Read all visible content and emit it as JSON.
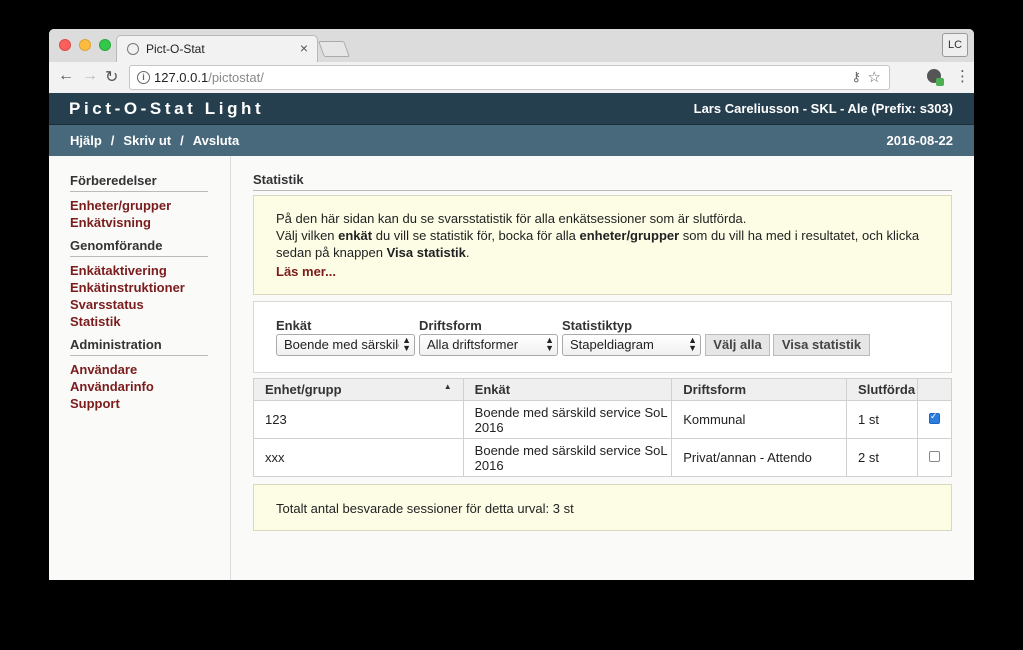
{
  "browser": {
    "tab_title": "Pict-O-Stat",
    "tab_close": "×",
    "profile": "LC",
    "url_host": "127.0.0.1",
    "url_path": "/pictostat/"
  },
  "header": {
    "app_title": "Pict-O-Stat Light",
    "user": "Lars Careliusson - SKL - Ale (Prefix: s303)"
  },
  "menu": {
    "items": [
      "Hjälp",
      "Skriv ut",
      "Avsluta"
    ],
    "separator": "/",
    "date": "2016-08-22"
  },
  "sidebar": {
    "sections": [
      {
        "heading": "Förberedelser",
        "items": [
          "Enheter/grupper",
          "Enkätvisning"
        ]
      },
      {
        "heading": "Genomförande",
        "items": [
          "Enkätaktivering",
          "Enkätinstruktioner",
          "Svarsstatus",
          "Statistik"
        ]
      },
      {
        "heading": "Administration",
        "items": [
          "Användare",
          "Användarinfo",
          "Support"
        ]
      }
    ]
  },
  "main": {
    "title": "Statistik",
    "info": {
      "line1": "På den här sidan kan du se svarsstatistik för alla enkätsessioner som är slutförda.",
      "line2_a": "Välj vilken ",
      "line2_b": "enkät",
      "line2_c": " du vill se statistik för, bocka för alla ",
      "line2_d": "enheter/grupper",
      "line2_e": " som du vill ha med i resultatet, och klicka",
      "line3_a": "sedan på knappen ",
      "line3_b": "Visa statistik",
      "line3_c": ".",
      "more": "Läs mer..."
    },
    "filters": {
      "enkat_label": "Enkät",
      "enkat_value": "Boende med särskild service SoL 2016",
      "driftsform_label": "Driftsform",
      "driftsform_value": "Alla driftsformer",
      "statistiktyp_label": "Statistiktyp",
      "statistiktyp_value": "Stapeldiagram",
      "select_all": "Välj alla",
      "show_stats": "Visa statistik"
    },
    "table": {
      "headers": [
        "Enhet/grupp",
        "Enkät",
        "Driftsform",
        "Slutförda"
      ],
      "sort_indicator": "▲",
      "rows": [
        {
          "unit": "123",
          "survey_l1": "Boende med särskild service SoL",
          "survey_l2": "2016",
          "form": "Kommunal",
          "done": "1 st",
          "checked": true
        },
        {
          "unit": "xxx",
          "survey_l1": "Boende med särskild service SoL",
          "survey_l2": "2016",
          "form": "Privat/annan - Attendo",
          "done": "2 st",
          "checked": false
        }
      ]
    },
    "total": "Totalt antal besvarade sessioner för detta urval: 3 st"
  }
}
